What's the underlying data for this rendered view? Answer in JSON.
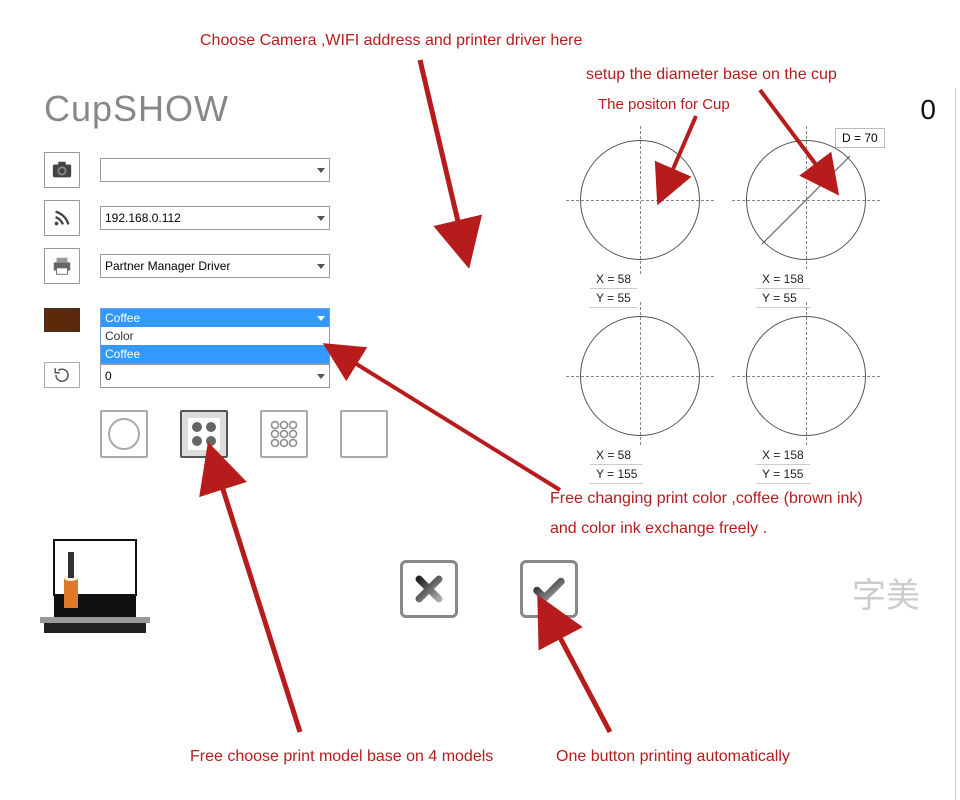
{
  "logo": {
    "part1": "Cup",
    "part2": "SHOW"
  },
  "inputs": {
    "camera": "",
    "wifi": "192.168.0.112",
    "printer": "Partner Manager Driver",
    "ink_header": "Coffee",
    "ink_options": [
      "Color",
      "Coffee"
    ],
    "rotate_value": "0"
  },
  "cups": {
    "diameter": "D = 70",
    "positions": [
      {
        "x": "X = 58",
        "y": "Y = 55"
      },
      {
        "x": "X = 158",
        "y": "Y = 55"
      },
      {
        "x": "X = 58",
        "y": "Y = 155"
      },
      {
        "x": "X = 158",
        "y": "Y = 155"
      }
    ],
    "count_display": "0"
  },
  "brand_cn": "字美",
  "annotations": {
    "top": "Choose Camera ,WIFI address and printer driver here",
    "diam": "setup the diameter base on the cup",
    "position": "The positon for  Cup",
    "ink": "Free changing print color ,coffee (brown ink)",
    "ink2": "and color ink exchange freely .",
    "models": "Free choose print model base on 4 models",
    "onebtn": "One button printing automatically"
  }
}
